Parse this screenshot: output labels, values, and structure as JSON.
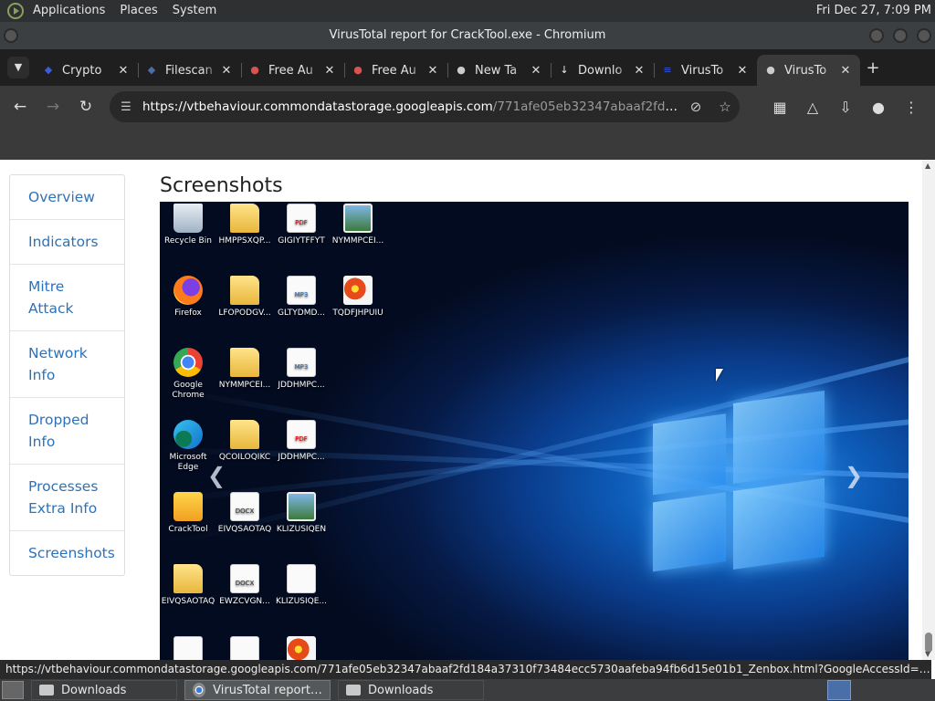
{
  "panel": {
    "menus": [
      "Applications",
      "Places",
      "System"
    ],
    "clock": "Fri Dec 27,  7:09 PM"
  },
  "window": {
    "title": "VirusTotal report for CrackTool.exe - Chromium"
  },
  "tabs": [
    {
      "label": "Crypto",
      "icon": "shield-icon",
      "color": "#3b5bdb"
    },
    {
      "label": "Filescan",
      "icon": "shield-icon",
      "color": "#4a6fa5"
    },
    {
      "label": "Free Au",
      "icon": "globe-icon",
      "color": "#d9534f"
    },
    {
      "label": "Free Au",
      "icon": "globe-icon",
      "color": "#d9534f"
    },
    {
      "label": "New Ta",
      "icon": "globe-icon",
      "color": "#cccccc"
    },
    {
      "label": "Downlo",
      "icon": "download-icon",
      "color": "#eeeeee"
    },
    {
      "label": "VirusTo",
      "icon": "virustotal-icon",
      "color": "#3953d8"
    },
    {
      "label": "VirusTo",
      "icon": "globe-icon",
      "color": "#cccccc",
      "active": true
    }
  ],
  "address": {
    "host": "https://vtbehaviour.commondatastorage.googleapis.com",
    "path": "/771afe05eb32347abaaf2fd184a37..."
  },
  "sidebar": [
    "Overview",
    "Indicators",
    "Mitre Attack",
    "Network Info",
    "Dropped Info",
    "Processes Extra Info",
    "Screenshots"
  ],
  "section_title": "Screenshots",
  "desktop_icons": [
    {
      "label": "Recycle Bin",
      "kind": "bin"
    },
    {
      "label": "HMPPSXQP...",
      "kind": "folder"
    },
    {
      "label": "GIGIYTFFYT",
      "kind": "pdf"
    },
    {
      "label": "NYMMPCEI...",
      "kind": "pic"
    },
    {
      "label": "Firefox",
      "kind": "ff"
    },
    {
      "label": "LFOPODGV...",
      "kind": "folder"
    },
    {
      "label": "GLTYDMD...",
      "kind": "mp3"
    },
    {
      "label": "TQDFJHPUIU",
      "kind": "flower"
    },
    {
      "label": "Google Chrome",
      "kind": "chrome"
    },
    {
      "label": "NYMMPCEI...",
      "kind": "folder"
    },
    {
      "label": "JDDHMPC...",
      "kind": "mp3"
    },
    {
      "label": "",
      "kind": "none"
    },
    {
      "label": "Microsoft Edge",
      "kind": "edge"
    },
    {
      "label": "QCOILOQIKC",
      "kind": "folder"
    },
    {
      "label": "JDDHMPC...",
      "kind": "pdf"
    },
    {
      "label": "",
      "kind": "none"
    },
    {
      "label": "CrackTool",
      "kind": "crack"
    },
    {
      "label": "EIVQSAOTAQ",
      "kind": "docx"
    },
    {
      "label": "KLIZUSIQEN",
      "kind": "pic"
    },
    {
      "label": "",
      "kind": "none"
    },
    {
      "label": "EIVQSAOTAQ",
      "kind": "folder"
    },
    {
      "label": "EWZCVGN...",
      "kind": "docx"
    },
    {
      "label": "KLIZUSIQE...",
      "kind": "blank"
    },
    {
      "label": "",
      "kind": "none"
    },
    {
      "label": "",
      "kind": "blank"
    },
    {
      "label": "",
      "kind": "blank"
    },
    {
      "label": "",
      "kind": "flower"
    }
  ],
  "icon_text": {
    "pdf": "PDF",
    "mp3": "MP3",
    "docx": "DOCX"
  },
  "status_url": "https://vtbehaviour.commondatastorage.googleapis.com/771afe05eb32347abaaf2fd184a37310f73484ecc5730aafeba94fb6d15e01b1_Zenbox.html?GoogleAccessId=75...",
  "taskbar": [
    {
      "label": "Downloads",
      "kind": "folder"
    },
    {
      "label": "VirusTotal report fo...",
      "kind": "chromium",
      "active": true
    },
    {
      "label": "Downloads",
      "kind": "folder"
    }
  ]
}
